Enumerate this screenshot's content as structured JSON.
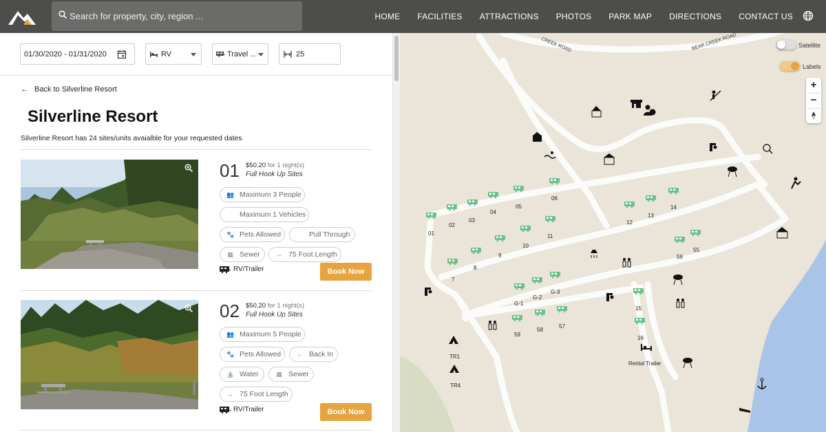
{
  "header": {
    "search_placeholder": "Search for property, city, region ...",
    "nav": [
      "HOME",
      "FACILITIES",
      "ATTRACTIONS",
      "PHOTOS",
      "PARK MAP",
      "DIRECTIONS",
      "CONTACT US"
    ]
  },
  "filters": {
    "dates": "01/30/2020  -  01/31/2020",
    "equipment": "RV",
    "equipment_type": "Travel ...",
    "length": "25"
  },
  "resort": {
    "back_label": "Back to Silverline Resort",
    "title": "Silverline Resort",
    "availability": "Silverline Resort has 24 sites/units avaialble for your requested dates"
  },
  "sites": [
    {
      "number": "01",
      "price": "$50.20",
      "nights": "for 1 night(s)",
      "type": "Full Hook Up Sites",
      "features": [
        "Maximum 3 People",
        "Maximum 1 Vehicles",
        "Pets Allowed",
        "Pull Through",
        "Sewer",
        "75 Foot Length"
      ],
      "equipment": "RV/Trailer",
      "book_label": "Book Now"
    },
    {
      "number": "02",
      "price": "$50.20",
      "nights": "for 1 night(s)",
      "type": "Full Hook Up Sites",
      "features": [
        "Maximum 5 People",
        "Pets Allowed",
        "Back In",
        "Water",
        "Sewer",
        "75 Foot Length"
      ],
      "equipment": "RV/Trailer",
      "book_label": "Book Now"
    }
  ],
  "map": {
    "roads": [
      "CREEK ROAD",
      "BEAR CREEK ROAD"
    ],
    "toggles": {
      "satellite": "Satellite",
      "labels": "Labels"
    },
    "zoom_in": "+",
    "zoom_out": "−",
    "site_labels": [
      "01",
      "02",
      "03",
      "04",
      "05",
      "06",
      "7",
      "8",
      "9",
      "10",
      "11",
      "12",
      "13",
      "14",
      "55",
      "56",
      "G-1",
      "G-2",
      "G-3",
      "59",
      "58",
      "57",
      "15",
      "16",
      "TR1",
      "TR4"
    ],
    "rental_label": "Rental Trailer"
  },
  "colors": {
    "accent": "#e6a33e",
    "header": "#4d4d4b",
    "site_marker": "#6cc08b",
    "water": "#a9c4e6"
  }
}
